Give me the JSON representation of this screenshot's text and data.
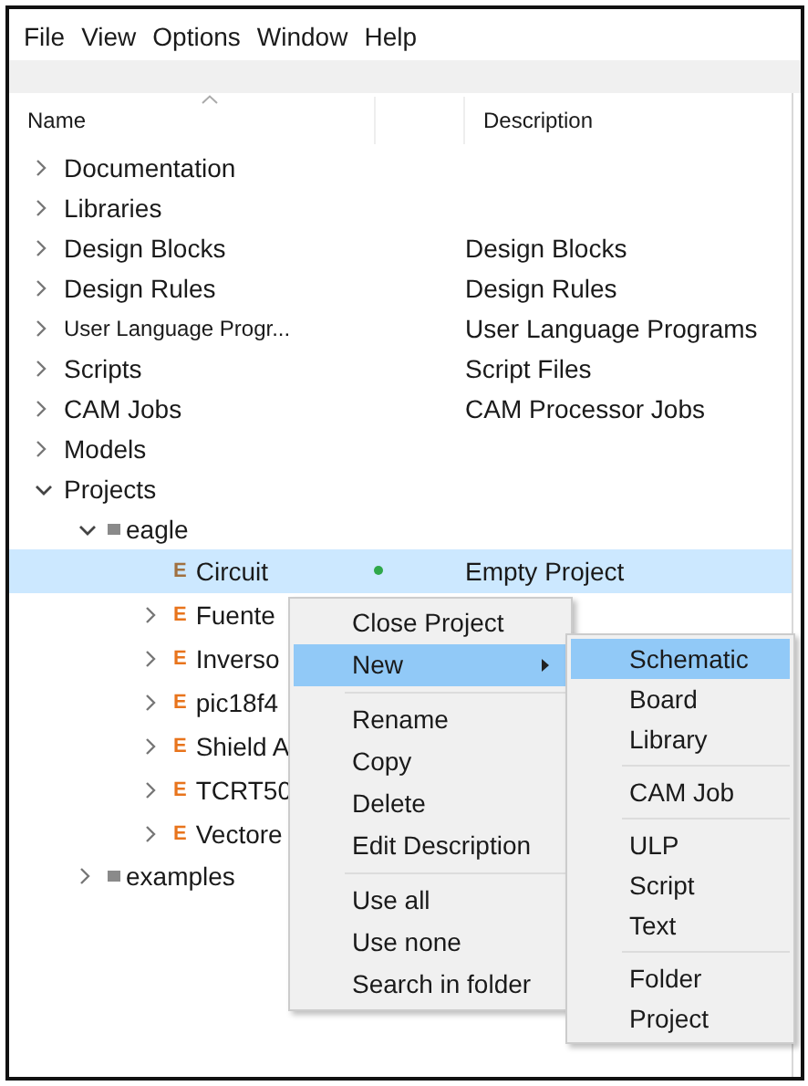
{
  "menu_bar": [
    "File",
    "View",
    "Options",
    "Window",
    "Help"
  ],
  "columns": [
    "Name",
    "Description"
  ],
  "tree": [
    {
      "label": "Documentation",
      "kind": "category",
      "expanded": false,
      "selected": false
    },
    {
      "label": "Libraries",
      "kind": "category",
      "expanded": false,
      "selected": false
    },
    {
      "label": "Design Blocks",
      "description": "Design Blocks",
      "kind": "category",
      "expanded": false,
      "selected": false
    },
    {
      "label": "Design Rules",
      "description": "Design Rules",
      "kind": "category",
      "expanded": false,
      "selected": false
    },
    {
      "label": "User Language Progr...",
      "description": "User Language Programs",
      "kind": "category",
      "expanded": false,
      "selected": false
    },
    {
      "label": "Scripts",
      "description": "Script Files",
      "kind": "category",
      "expanded": false,
      "selected": false
    },
    {
      "label": "CAM Jobs",
      "description": "CAM Processor Jobs",
      "kind": "category",
      "expanded": false,
      "selected": false
    },
    {
      "label": "Models",
      "kind": "category",
      "expanded": false,
      "selected": false
    },
    {
      "label": "Projects",
      "kind": "category",
      "expanded": true,
      "selected": false,
      "children": [
        {
          "label": "eagle",
          "kind": "folder",
          "expanded": true,
          "selected": false,
          "children": [
            {
              "label": "Circuit",
              "description": "Empty Project",
              "kind": "project",
              "open": true,
              "selected": true,
              "badge": "E"
            },
            {
              "label": "Fuente",
              "kind": "project",
              "open": false,
              "expanded": false,
              "selected": false,
              "badge": "E"
            },
            {
              "label": "Inverso",
              "kind": "project",
              "open": false,
              "expanded": false,
              "selected": false,
              "badge": "E"
            },
            {
              "label": "pic18f4",
              "kind": "project",
              "open": false,
              "expanded": false,
              "selected": false,
              "badge": "E"
            },
            {
              "label": "Shield A",
              "kind": "project",
              "open": false,
              "expanded": false,
              "selected": false,
              "badge": "E"
            },
            {
              "label": "TCRT50",
              "kind": "project",
              "open": false,
              "expanded": false,
              "selected": false,
              "badge": "E"
            },
            {
              "label": "Vectore",
              "kind": "project",
              "open": false,
              "expanded": false,
              "selected": false,
              "badge": "E"
            }
          ]
        },
        {
          "label": "examples",
          "kind": "folder",
          "expanded": false,
          "selected": false
        }
      ]
    }
  ],
  "context_menu": {
    "groups": [
      [
        {
          "label": "Close Project",
          "selected": false,
          "has_submenu": false
        },
        {
          "label": "New",
          "selected": true,
          "has_submenu": true
        }
      ],
      [
        {
          "label": "Rename",
          "selected": false,
          "has_submenu": false
        },
        {
          "label": "Copy",
          "selected": false,
          "has_submenu": false
        },
        {
          "label": "Delete",
          "selected": false,
          "has_submenu": false
        },
        {
          "label": "Edit Description",
          "selected": false,
          "has_submenu": false
        }
      ],
      [
        {
          "label": "Use all",
          "selected": false,
          "has_submenu": false
        },
        {
          "label": "Use none",
          "selected": false,
          "has_submenu": false
        },
        {
          "label": "Search in folder",
          "selected": false,
          "has_submenu": false
        }
      ]
    ]
  },
  "submenu": {
    "groups": [
      [
        {
          "label": "Schematic",
          "selected": true
        },
        {
          "label": "Board",
          "selected": false
        },
        {
          "label": "Library",
          "selected": false
        }
      ],
      [
        {
          "label": "CAM Job",
          "selected": false
        }
      ],
      [
        {
          "label": "ULP",
          "selected": false
        },
        {
          "label": "Script",
          "selected": false
        },
        {
          "label": "Text",
          "selected": false
        }
      ],
      [
        {
          "label": "Folder",
          "selected": false
        },
        {
          "label": "Project",
          "selected": false
        }
      ]
    ]
  }
}
